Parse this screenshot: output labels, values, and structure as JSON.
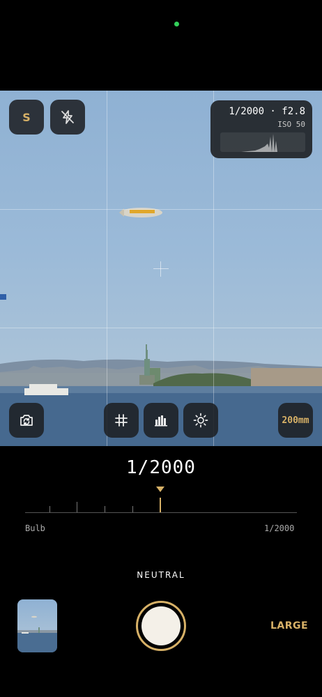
{
  "top_controls": {
    "mode_button_label": "S",
    "flash_icon": "flash-off-icon"
  },
  "exposure_info": {
    "summary": "1/2000 · f2.8",
    "iso": "ISO 50"
  },
  "bottom_overlay": {
    "switch_camera_icon": "switch-camera-icon",
    "grid_icon": "grid-icon",
    "histogram_icon": "histogram-icon",
    "exposure_icon": "sun-icon",
    "lens_label": "200mm"
  },
  "shutter": {
    "current_value": "1/2000",
    "dial_min_label": "Bulb",
    "dial_max_label": "1/2000"
  },
  "mode": {
    "label": "NEUTRAL"
  },
  "capture": {
    "size_label": "LARGE"
  },
  "colors": {
    "accent": "#d7b167",
    "background": "#000000",
    "recording_dot": "#33d05a"
  }
}
